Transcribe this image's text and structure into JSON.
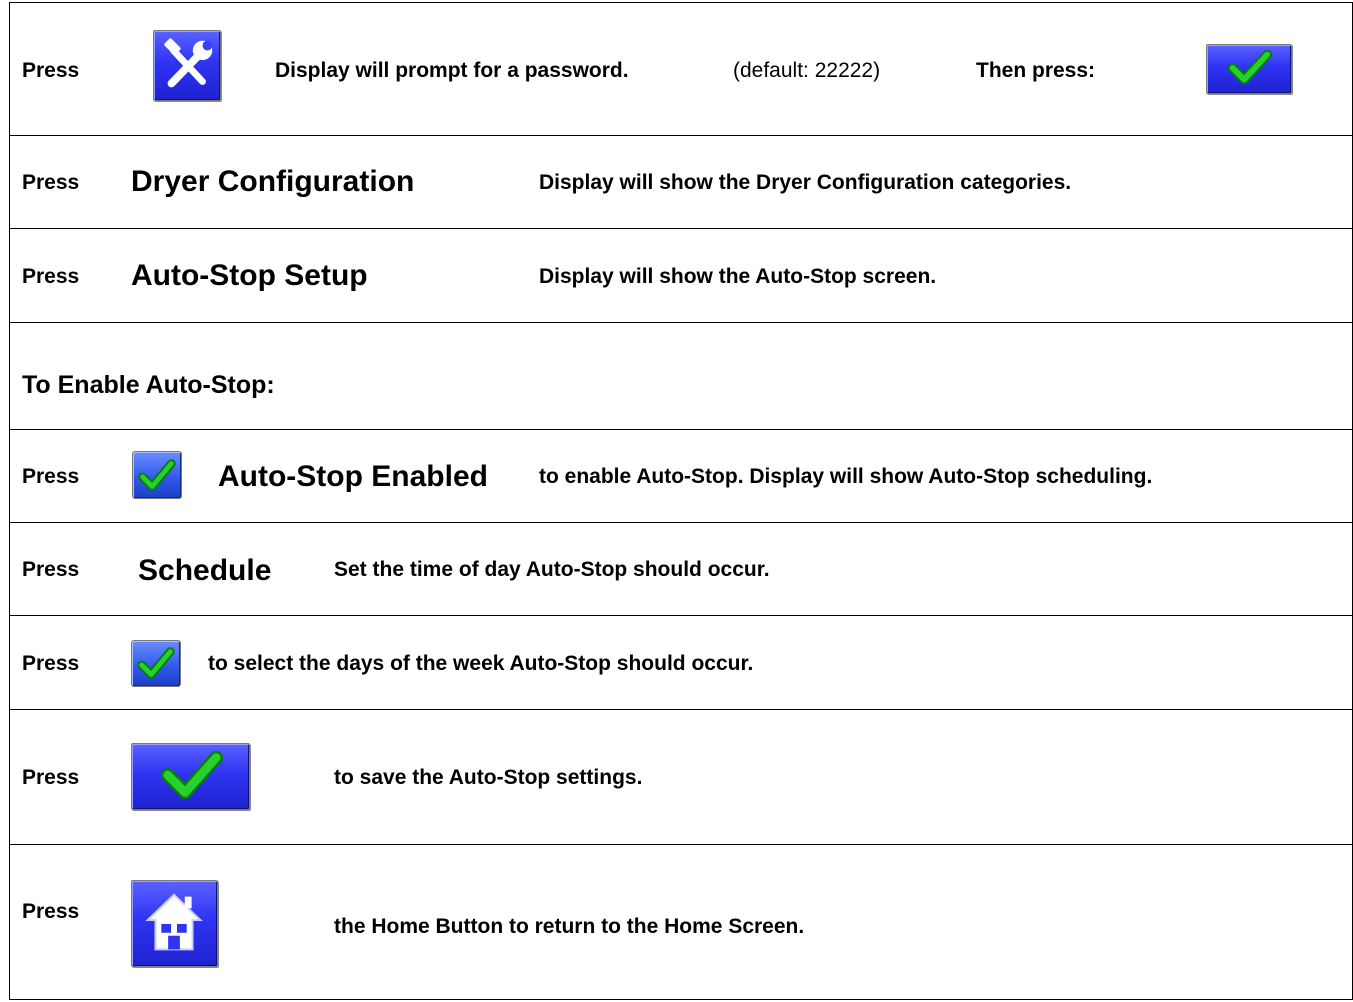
{
  "steps": {
    "s1": {
      "press": "Press",
      "icon": "tools-icon",
      "desc": "Display will prompt for a password.",
      "note": "(default: 22222)",
      "then": "Then press:",
      "confirm_icon": "check-icon"
    },
    "s2": {
      "press": "Press",
      "target": "Dryer Configuration",
      "desc": "Display will show the Dryer Configuration categories."
    },
    "s3": {
      "press": "Press",
      "target": "Auto-Stop Setup",
      "desc": "Display will show the Auto-Stop screen."
    },
    "section_heading": "To Enable Auto-Stop:",
    "s4": {
      "press": "Press",
      "icon": "checkbox-checked-icon",
      "target": "Auto-Stop Enabled",
      "desc": "to enable Auto-Stop.  Display will show Auto-Stop scheduling."
    },
    "s5": {
      "press": "Press",
      "target": "Schedule",
      "desc": "Set the time of day Auto-Stop should occur."
    },
    "s6": {
      "press": "Press",
      "icon": "checkbox-checked-icon",
      "desc": "to select the days of the week Auto-Stop should occur."
    },
    "s7": {
      "press": "Press",
      "icon": "check-icon",
      "desc": "to save the Auto-Stop settings."
    },
    "s8": {
      "press": "Press",
      "icon": "home-icon",
      "desc": "the Home Button to return to the Home Screen."
    }
  },
  "colors": {
    "button_blue": "#2f34f2",
    "checkbox_blue": "#2e57e8",
    "check_green": "#19c41e"
  }
}
